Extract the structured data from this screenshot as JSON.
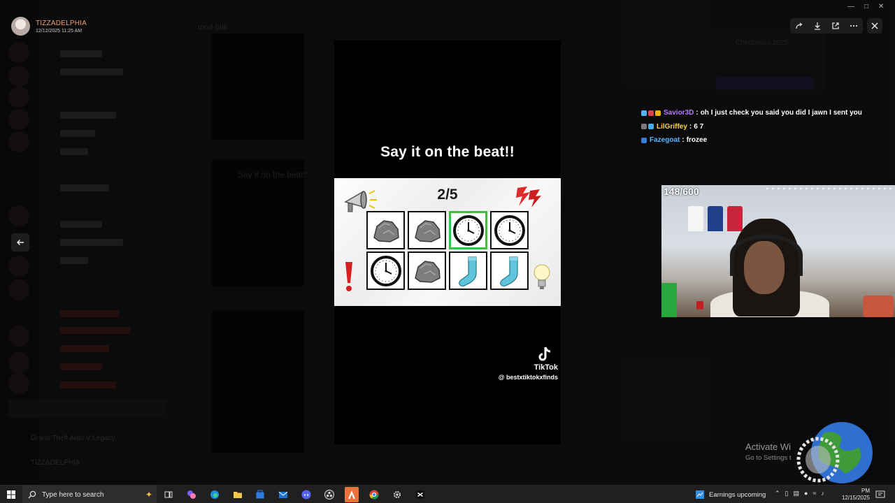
{
  "poster": {
    "name": "TIZZADELPHIA",
    "timestamp": "12/12/2025 11:25 AM"
  },
  "background": {
    "header_title": "mod-talk",
    "game_label": "Grand Theft Auto V Legacy",
    "user_label": "TIZZADELPHIA",
    "feed_text": "Say it on the beat!!",
    "right_card_title": "Checkpoint 2025"
  },
  "viewer": {
    "toolbar_icons": [
      "forward-icon",
      "download-icon",
      "open-external-icon",
      "more-icon"
    ],
    "close_icon": "close-icon",
    "back_icon": "arrow-left-icon"
  },
  "video": {
    "caption": "Say it on the beat!!",
    "score": "2/5",
    "grid": [
      [
        "rock",
        "rock",
        "clock",
        "clock"
      ],
      [
        "clock",
        "rock",
        "sock",
        "sock"
      ]
    ],
    "active_tile": [
      0,
      2
    ],
    "watermark_brand": "TikTok",
    "watermark_handle": "@ bestxtiktokxfinds"
  },
  "chat": [
    {
      "user": "Savior3D",
      "color": "#b77bff",
      "badges": [
        "#4fb3ff",
        "#e0404a",
        "#f0b400"
      ],
      "message": "oh I just check you said you did I jawn I sent you"
    },
    {
      "user": "LilGriffey",
      "color": "#ffd24a",
      "badges": [
        "#7a7a7a",
        "#3fb0e8"
      ],
      "message": "6 7"
    },
    {
      "user": "Fazegoat",
      "color": "#58b8ff",
      "badges": [
        "#3a7bd5"
      ],
      "message": "frozee"
    }
  ],
  "webcam": {
    "follower_goal": "148/600"
  },
  "watermark": {
    "title": "Activate Wi",
    "subtitle": "Go to Settings t"
  },
  "taskbar": {
    "search_placeholder": "Type here to search",
    "earnings_label": "Earnings upcoming",
    "time": "PM",
    "date": "12/15/2025"
  },
  "colors": {
    "accent_green": "#3fbf3f",
    "active_app": "#e9733b"
  }
}
